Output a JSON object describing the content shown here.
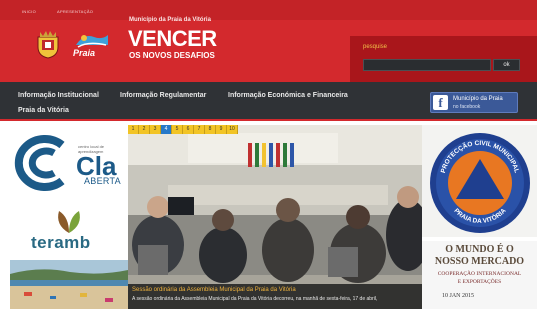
{
  "header": {
    "top_links": [
      "INICIO",
      "APRESENTAÇÃO"
    ],
    "brand_name": "Praia",
    "municipality": "Município da Praia da Vitória",
    "slogan_main": "VENCER",
    "slogan_sub": "OS NOVOS DESAFIOS",
    "colors": {
      "primary": "#d3292d",
      "accent": "#f1c048"
    }
  },
  "search": {
    "label": "pesquise",
    "placeholder": "",
    "button_label": "ok"
  },
  "nav": {
    "items": [
      "Informação Institucional",
      "Informação Regulamentar",
      "Informação Económica e Financeira",
      "Praia da Vitória"
    ],
    "facebook": {
      "line1": "Município da Praia",
      "line2": "no facebook",
      "icon": "facebook-icon"
    }
  },
  "left_banners": {
    "ccla": {
      "title": "Cla",
      "subtitle": "ABERTA",
      "small": "centro local de aprendizagem"
    },
    "teramb": {
      "title": "teramb"
    }
  },
  "slider": {
    "pages": [
      "1",
      "2",
      "3",
      "4",
      "5",
      "6",
      "7",
      "8",
      "9",
      "10"
    ],
    "active_page": "4",
    "caption_title": "Sessão ordinária da Assembleia Municipal da Praia da Vitória",
    "caption_text": "A sessão ordinária da Assembleia Municipal da Praia da Vitória decorreu, na manhã de sexta-feira, 17 de abril,"
  },
  "right_banners": {
    "civil": {
      "top_text": "PROTECÇÃO CIVIL MUNICIPAL",
      "bottom_text": "PRAIA DA VITÓRIA"
    },
    "mercado": {
      "line1": "O MUNDO É O",
      "line2": "NOSSO MERCADO",
      "line3": "COOPERAÇÃO INTERNACIONAL",
      "line4": "E EXPORTAÇÕES",
      "line5": "10 JAN 2015"
    }
  }
}
